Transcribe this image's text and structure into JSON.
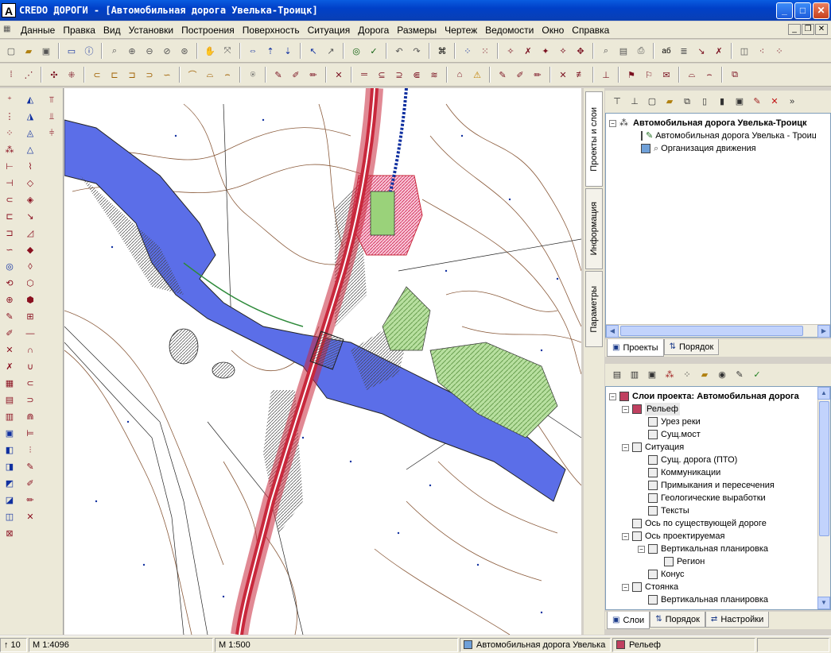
{
  "window": {
    "app_icon": "A",
    "title": "CREDO ДОРОГИ - [Автомобильная дорога Увелька-Троицк]",
    "minimize": "_",
    "maximize": "□",
    "close": "✕"
  },
  "menu": [
    "Данные",
    "Правка",
    "Вид",
    "Установки",
    "Построения",
    "Поверхность",
    "Ситуация",
    "Дорога",
    "Размеры",
    "Чертеж",
    "Ведомости",
    "Окно",
    "Справка"
  ],
  "vertical_tabs": {
    "projects_layers": "Проекты и слои",
    "information": "Информация",
    "parameters": "Параметры"
  },
  "projects_tree": {
    "root": "Автомобильная дорога Увелька-Троицк",
    "items": [
      "Автомобильная дорога Увелька - Троицк",
      "Организация движения"
    ]
  },
  "projects_tabs": {
    "projects": "Проекты",
    "order": "Порядок"
  },
  "layers_tree": {
    "root": "Слои проекта: Автомобильная дорога",
    "items": [
      {
        "label": "Рельеф",
        "level": 1,
        "expander": "−",
        "selected": true
      },
      {
        "label": "Урез реки",
        "level": 2
      },
      {
        "label": "Сущ.мост",
        "level": 2
      },
      {
        "label": "Ситуация",
        "level": 1,
        "expander": "−"
      },
      {
        "label": "Сущ. дорога (ПТО)",
        "level": 2
      },
      {
        "label": "Коммуникации",
        "level": 2
      },
      {
        "label": "Примыкания и пересечения",
        "level": 2
      },
      {
        "label": "Геологические выработки",
        "level": 2
      },
      {
        "label": "Тексты",
        "level": 2
      },
      {
        "label": "Ось по существующей дороге",
        "level": 1
      },
      {
        "label": "Ось проектируемая",
        "level": 1,
        "expander": "−"
      },
      {
        "label": "Вертикальная планировка",
        "level": 2,
        "expander": "−"
      },
      {
        "label": "Регион",
        "level": 3
      },
      {
        "label": "Конус",
        "level": 2
      },
      {
        "label": "Стоянка",
        "level": 1,
        "expander": "−"
      },
      {
        "label": "Вертикальная планировка",
        "level": 2
      }
    ]
  },
  "layers_tabs": {
    "layers": "Слои",
    "order": "Порядок",
    "settings": "Настройки"
  },
  "status": {
    "zoom": "10",
    "scale": "М 1:4096",
    "drawing_scale": "М 1:500",
    "active_project": "Автомобильная дорога Увелька",
    "active_layer": "Рельеф"
  },
  "colors": {
    "water": "#5b6ee8",
    "road": "#c8283c",
    "vegetation": "#9ad27a",
    "contour": "#8a5a3a"
  }
}
